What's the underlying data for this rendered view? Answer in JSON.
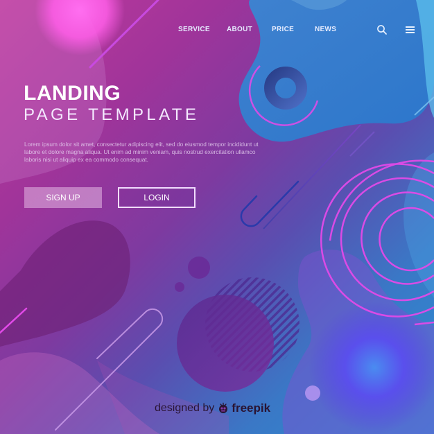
{
  "nav": {
    "links": [
      {
        "label": "SERVICE"
      },
      {
        "label": "ABOUT"
      },
      {
        "label": "PRICE"
      },
      {
        "label": "NEWS"
      }
    ],
    "icons": [
      "search-icon",
      "hamburger-menu-icon"
    ]
  },
  "hero": {
    "title": "LANDING",
    "subtitle": "PAGE TEMPLATE",
    "description": "Lorem ipsum dolor sit amet, consectetur adipiscing elit, sed do eiusmod tempor incididunt ut labore et dolore magna aliqua. Ut enim ad minim veniam, quis nostrud exercitation ullamco laboris nisi ut aliquip ex ea commodo consequat."
  },
  "buttons": {
    "signup_label": "SIGN UP",
    "login_label": "LOGIN"
  },
  "credit": {
    "prefix": "designed by",
    "brand": "freepik"
  },
  "colors": {
    "accent_magenta": "#e040e8",
    "primary_blue": "#2a8fd4",
    "primary_purple": "#7e3aa0",
    "text_white": "#ffffff"
  }
}
